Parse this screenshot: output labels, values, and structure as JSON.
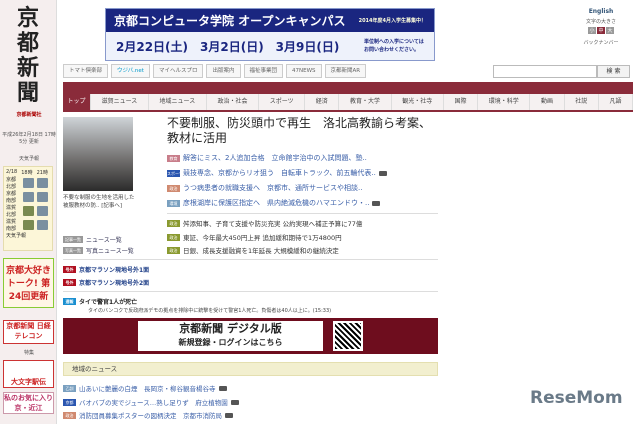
{
  "logo": "京都新聞",
  "sidebar": {
    "company": "京都新聞社",
    "updated": "平成26年2月18日 17時5分 更新",
    "weather_title": "天気予報",
    "weather_header": [
      "2/18",
      "18時",
      "21時"
    ],
    "regions": [
      "京都北部",
      "京都南部",
      "滋賀北部",
      "滋賀南部"
    ],
    "weather_link": "天気予報",
    "ad1": "京都大好きトーク! 第24回更新",
    "ad2": "京都新聞 日経テレコン",
    "feature_label": "特集",
    "ad3": "大文字駅伝",
    "ad4": "私のお気に入り京・近江"
  },
  "banner": {
    "title": "京都コンピュータ学院 オープンキャンパス",
    "note": "2014年度4月入学生募集中！",
    "dates": "2月22日(土)　3月2日(日)　3月9日(日)",
    "info": "単位制への入学については お問い合わせください。"
  },
  "top_right": {
    "english": "English",
    "font_size": "文字の大きさ",
    "sizes": [
      "小",
      "中",
      "大"
    ],
    "backnumber": "バックナンバー"
  },
  "toolbar": [
    "トマト倶楽部",
    "ウジバ.net",
    "マイヘルスプロ",
    "出版案内",
    "福祉事業団",
    "47NEWS",
    "京都新聞AR"
  ],
  "search": {
    "button": "検 索",
    "value": ""
  },
  "tabs": [
    "トップ",
    "滋賀ニュース",
    "地域ニュース",
    "政治・社会",
    "スポーツ",
    "経済",
    "教育・大学",
    "観光・社寺",
    "国際",
    "環境・科学",
    "動画",
    "社説",
    "凡語"
  ],
  "top_story": {
    "headline": "不要制服、防災頭巾で再生　洛北高教諭ら考案、教材に活用",
    "caption": "不要な制服の生地を活用した被服教材の防.. [記事へ]"
  },
  "news": [
    {
      "tag": "教育",
      "title": "解答にミス、2人追加合格　立命館宇治中の入試問題、塾..",
      "color": "#c87d8a",
      "cam": false
    },
    {
      "tag": "スポーツ",
      "title": "競技専念、京都からリオ狙う　自転車トラック、前五輪代表..",
      "color": "#2a56b0",
      "cam": true
    },
    {
      "tag": "政治",
      "title": "うつ病患者の就職支援へ　京都市、通所サービスや相談..",
      "color": "#d08a70",
      "cam": false
    },
    {
      "tag": "環境",
      "title": "彦根湖岸に保護区指定へ　県内絶滅危機のハマエンドウ・..",
      "color": "#7aa0c0",
      "cam": true
    }
  ],
  "politics": [
    {
      "tag": "政治",
      "title": "舛添知事、子育て支援や防災充実 公約実現へ補正予算に77億"
    },
    {
      "tag": "政治",
      "title": "東証、今年最大450円上昇 追加緩和期待で1万4800円"
    },
    {
      "tag": "政治",
      "title": "日銀、成長支援融資を1年延長 大規模緩和の継続決定"
    }
  ],
  "list_links": [
    {
      "tag": "記事一覧",
      "label": "ニュース一覧"
    },
    {
      "tag": "写真一覧",
      "label": "写真ニュース一覧"
    }
  ],
  "extras": [
    {
      "tag": "号外",
      "title": "京都マラソン現地号外1面"
    },
    {
      "tag": "号外",
      "title": "京都マラソン現地号外2面"
    }
  ],
  "breaking": {
    "tag": "速報",
    "title": "タイで警官1人が死亡",
    "body": "タイのバンコクで反政府派デモの拠点を排除中に銃撃を受けて警官1人死亡。負傷者は40人以上に。(15:33)"
  },
  "digital": {
    "line1": "京都新聞 デジタル版",
    "line2": "新規登録・ログインはこちら"
  },
  "regional": {
    "header": "地域のニュース",
    "items": [
      {
        "tag": "乙訓",
        "title": "山あいに艶麗の白煙　長岡京・柳谷観音楊谷寺",
        "color": "#7aa0c0"
      },
      {
        "tag": "京都",
        "title": "バオバブの実でジュース…熟し足りず　府立植物園",
        "color": "#2a56b0"
      },
      {
        "tag": "政治",
        "title": "消防団員募集ポスターの図柄決定　京都市消防局",
        "color": "#d08a70"
      }
    ]
  },
  "watermark": "ReseMom"
}
